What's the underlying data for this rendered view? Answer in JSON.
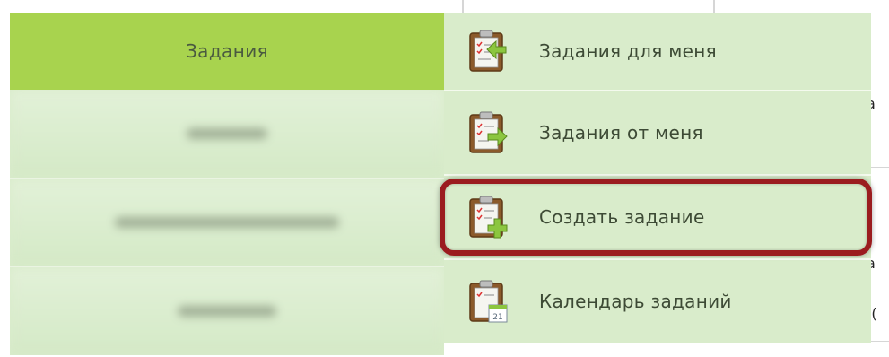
{
  "menu": {
    "active_tab_label": "Задания",
    "blurred_items_count": 3
  },
  "dropdown": {
    "items": [
      {
        "label": "Задания для меня",
        "icon": "clipboard-arrow-left-icon"
      },
      {
        "label": "Задания от меня",
        "icon": "clipboard-arrow-right-icon"
      },
      {
        "label": "Создать задание",
        "icon": "clipboard-plus-icon",
        "highlighted": true
      },
      {
        "label": "Календарь заданий",
        "icon": "clipboard-calendar-icon",
        "calendar_day": "21"
      }
    ]
  },
  "background": {
    "right_edge_text_1": "а",
    "right_edge_text_2": "а",
    "right_edge_text_3": ":("
  },
  "colors": {
    "active_tab": "#a8d34e",
    "menu_bg": "#d9eccb",
    "highlight_border": "#9b1c1f",
    "arrow_green": "#8cc63f"
  }
}
